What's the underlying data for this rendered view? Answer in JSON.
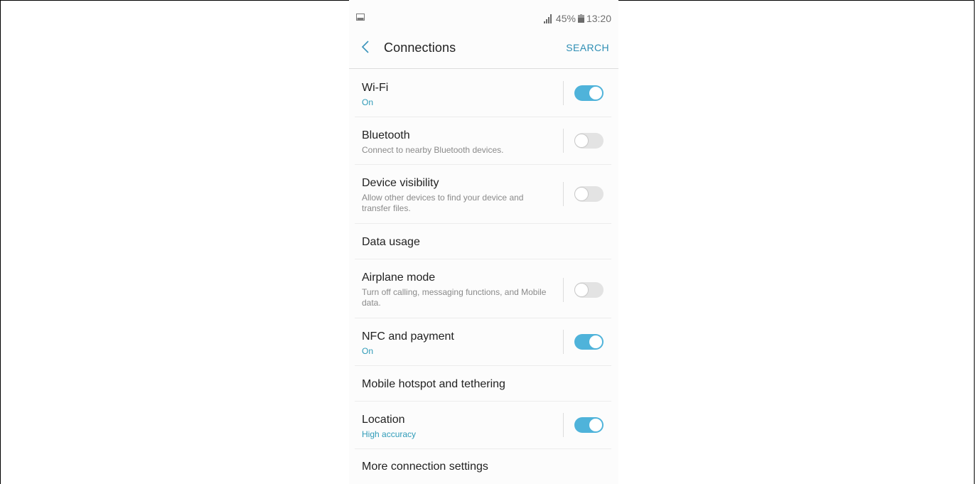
{
  "status_bar": {
    "left_icon": "image-notification-icon",
    "signal_icon": "signal-bars-icon",
    "battery_percent": "45%",
    "battery_icon": "battery-icon",
    "time": "13:20"
  },
  "header": {
    "back_icon": "chevron-left-icon",
    "title": "Connections",
    "search_label": "SEARCH"
  },
  "colors": {
    "accent": "#4fb3da",
    "link": "#2f8fb5",
    "on_text": "#2f9bb8"
  },
  "settings": [
    {
      "title": "Wi-Fi",
      "subtitle": "On",
      "toggle": true
    },
    {
      "title": "Bluetooth",
      "subtitle": "Connect to nearby Bluetooth devices.",
      "toggle": false
    },
    {
      "title": "Device visibility",
      "subtitle": "Allow other devices to find your device and transfer files.",
      "toggle": false
    },
    {
      "title": "Data usage"
    },
    {
      "title": "Airplane mode",
      "subtitle": "Turn off calling, messaging functions, and Mobile data.",
      "toggle": false
    },
    {
      "title": "NFC and payment",
      "subtitle": "On",
      "toggle": true
    },
    {
      "title": "Mobile hotspot and tethering"
    },
    {
      "title": "Location",
      "subtitle": "High accuracy",
      "toggle": true
    },
    {
      "title": "More connection settings"
    }
  ]
}
